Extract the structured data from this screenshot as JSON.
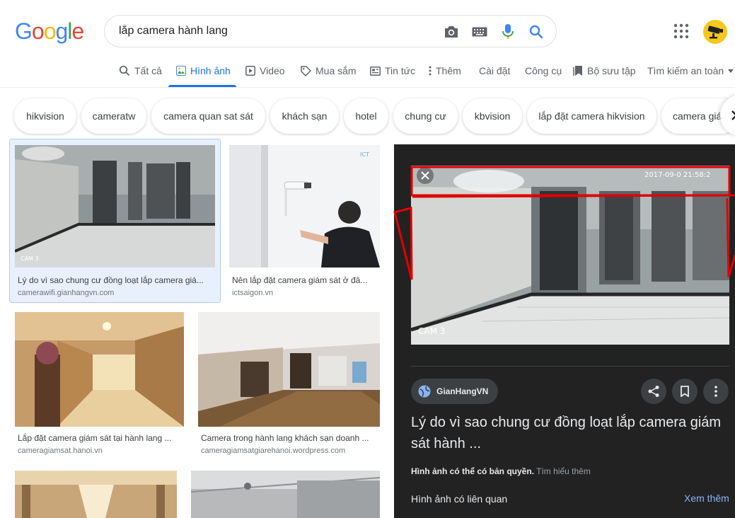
{
  "search": {
    "query": "lắp camera hành lang"
  },
  "tabs": [
    {
      "label": "Tất cả"
    },
    {
      "label": "Hình ảnh"
    },
    {
      "label": "Video"
    },
    {
      "label": "Mua sắm"
    },
    {
      "label": "Tin tức"
    },
    {
      "label": "Thêm"
    },
    {
      "label": "Cài đặt"
    },
    {
      "label": "Công cụ"
    },
    {
      "label": "Bộ sưu tập"
    },
    {
      "label": "Tìm kiếm an toàn"
    }
  ],
  "active_tab": "Hình ảnh",
  "chips": [
    "hikvision",
    "cameratw",
    "camera quan sat sát",
    "khách sạn",
    "hotel",
    "chung cư",
    "kbvision",
    "lắp đặt camera hikvision",
    "camera giá"
  ],
  "results": [
    {
      "caption": "Lý do vì sao chung cư đồng loạt lắp camera giá...",
      "source": "camerawifi.gianhangvn.com",
      "overlay": "CAM 3"
    },
    {
      "caption": "Nên lắp đặt camera giám sát ở đâ...",
      "source": "ictsaigon.vn"
    },
    {
      "caption": "Lắp đặt camera giám sát tại hành lang ...",
      "source": "cameragiamsat.hanoi.vn"
    },
    {
      "caption": "Camera trong hành lang khách sạn doanh ...",
      "source": "cameragiamsatgiarehanoi.wordpress.com"
    }
  ],
  "preview": {
    "source_name": "GianHangVN",
    "title": "Lý do vì sao chung cư đồng loạt lắp camera giám sát hành ...",
    "copyright": "Hình ảnh có thể có bản quyền.",
    "learn_more": "Tìm hiểu thêm",
    "related": "Hình ảnh có liên quan",
    "see_more": "Xem thêm",
    "cam_label": "CAM 3",
    "timestamp": "2017-09-0 21:58:2"
  },
  "colors": {
    "accent": "#1a73e8",
    "panel_bg": "#222222",
    "annotation": "#e00000"
  },
  "icons": {
    "camera_search": "camera-icon",
    "keyboard": "keyboard-icon",
    "voice": "mic-icon",
    "search": "search-icon",
    "apps": "apps-grid-icon"
  }
}
